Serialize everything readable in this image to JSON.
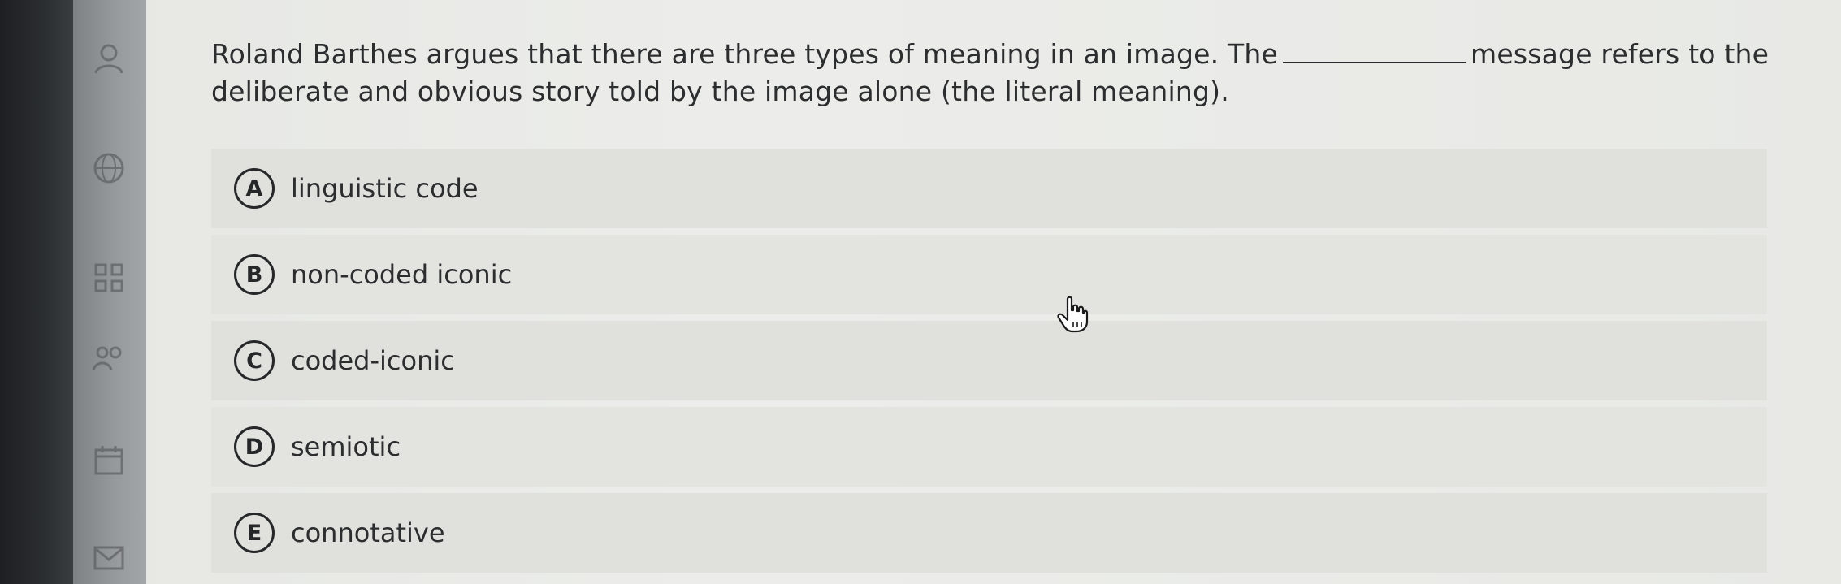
{
  "question": {
    "part1": "Roland Barthes argues that there are three types of meaning in an image. The",
    "part2": "message refers to the deliberate and obvious story told by the image alone (the literal meaning)."
  },
  "options": [
    {
      "letter": "A",
      "text": "linguistic code"
    },
    {
      "letter": "B",
      "text": "non-coded iconic"
    },
    {
      "letter": "C",
      "text": "coded-iconic"
    },
    {
      "letter": "D",
      "text": "semiotic"
    },
    {
      "letter": "E",
      "text": "connotative"
    }
  ],
  "icons": {
    "cursor": "hand-pointer-icon"
  }
}
